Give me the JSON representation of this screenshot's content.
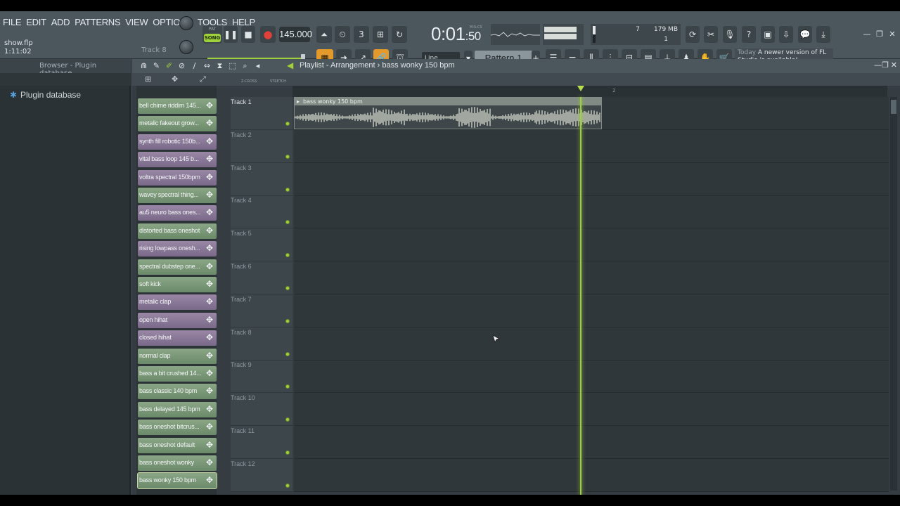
{
  "menu": [
    "FILE",
    "EDIT",
    "ADD",
    "PATTERNS",
    "VIEW",
    "OPTIONS",
    "TOOLS",
    "HELP"
  ],
  "project": {
    "filename": "show.flp",
    "position": "1:11:02",
    "hint_track": "Track 8"
  },
  "transport": {
    "pat_label": "PAT",
    "song_label": "SONG",
    "tempo": "145.000",
    "time_main": "0:01",
    "time_sub": ":50",
    "time_units": "M:S:CS"
  },
  "cpu": {
    "voices": "7",
    "memory": "179 MB",
    "polyphony": "1"
  },
  "snap": "Line",
  "pattern": "Pattern 1",
  "news": {
    "today": "Today",
    "message": "A newer version of FL Studio is available!"
  },
  "browser": {
    "title": "Browser - Plugin database",
    "root": "Plugin database"
  },
  "playlist": {
    "title": "Playlist - Arrangement › bass wonky 150 bpm",
    "ruler_marks": [
      "2"
    ],
    "zcross": "Z-CROSS",
    "stretch": "STRETCH",
    "clip_name": "bass wonky 150 bpm"
  },
  "picker": [
    {
      "label": "bell chime riddim 145...",
      "color": "green"
    },
    {
      "label": "metalic fakeout grow...",
      "color": "green"
    },
    {
      "label": "synth fill robotic 150b...",
      "color": "purple"
    },
    {
      "label": "vital bass loop 145 b...",
      "color": "purple"
    },
    {
      "label": "voltra spectral 150bpm",
      "color": "purple"
    },
    {
      "label": "wavey spectral thing...",
      "color": "green"
    },
    {
      "label": "au5 neuro bass ones...",
      "color": "purple"
    },
    {
      "label": "distorted bass oneshot",
      "color": "green"
    },
    {
      "label": "rising lowpass onesh...",
      "color": "purple"
    },
    {
      "label": "spectral dubstep one...",
      "color": "green"
    },
    {
      "label": "soft kick",
      "color": "green"
    },
    {
      "label": "metalic clap",
      "color": "purple"
    },
    {
      "label": "open hihat",
      "color": "purple"
    },
    {
      "label": "closed hihat",
      "color": "purple"
    },
    {
      "label": "normal clap",
      "color": "green"
    },
    {
      "label": "bass a bit crushed 14...",
      "color": "green"
    },
    {
      "label": "bass classic 140 bpm",
      "color": "green"
    },
    {
      "label": "bass delayed 145 bpm",
      "color": "green"
    },
    {
      "label": "bass oneshot bitcrus...",
      "color": "green"
    },
    {
      "label": "bass oneshot default",
      "color": "green"
    },
    {
      "label": "bass oneshot wonky",
      "color": "green"
    },
    {
      "label": "bass wonky 150 bpm",
      "color": "green"
    }
  ],
  "tracks": [
    "Track 1",
    "Track 2",
    "Track 3",
    "Track 4",
    "Track 5",
    "Track 6",
    "Track 7",
    "Track 8",
    "Track 9",
    "Track 10",
    "Track 11",
    "Track 12"
  ],
  "colors": {
    "accent": "#9fd13a",
    "chip_green": "#7a9877",
    "chip_purple": "#8a7898"
  }
}
